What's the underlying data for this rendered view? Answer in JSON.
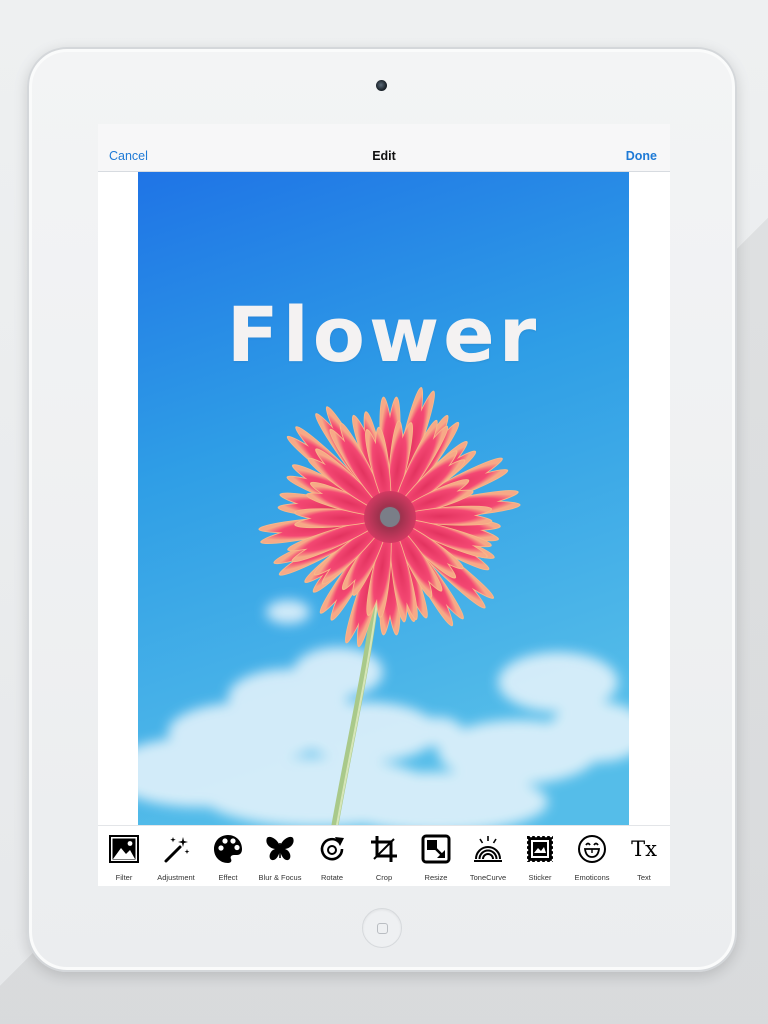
{
  "navbar": {
    "cancel_label": "Cancel",
    "title": "Edit",
    "done_label": "Done"
  },
  "photo": {
    "overlay_text": "Flower"
  },
  "toolbar": {
    "tools": [
      {
        "label": "Filter",
        "icon": "image-icon"
      },
      {
        "label": "Adjustment",
        "icon": "magic-wand-icon"
      },
      {
        "label": "Effect",
        "icon": "palette-icon"
      },
      {
        "label": "Blur & Focus",
        "icon": "butterfly-icon"
      },
      {
        "label": "Rotate",
        "icon": "rotate-icon"
      },
      {
        "label": "Crop",
        "icon": "crop-icon"
      },
      {
        "label": "Resize",
        "icon": "resize-icon"
      },
      {
        "label": "ToneCurve",
        "icon": "tone-curve-icon"
      },
      {
        "label": "Sticker",
        "icon": "sticker-icon"
      },
      {
        "label": "Emoticons",
        "icon": "emoticon-icon"
      },
      {
        "label": "Text",
        "icon": "text-icon",
        "glyph": "Tx"
      }
    ]
  },
  "colors": {
    "accent": "#1e7ad6",
    "sky_top": "#1f7de8",
    "sky_bottom": "#4ab6e6",
    "petal": "#f0456f",
    "petal_tip": "#f6b283"
  }
}
